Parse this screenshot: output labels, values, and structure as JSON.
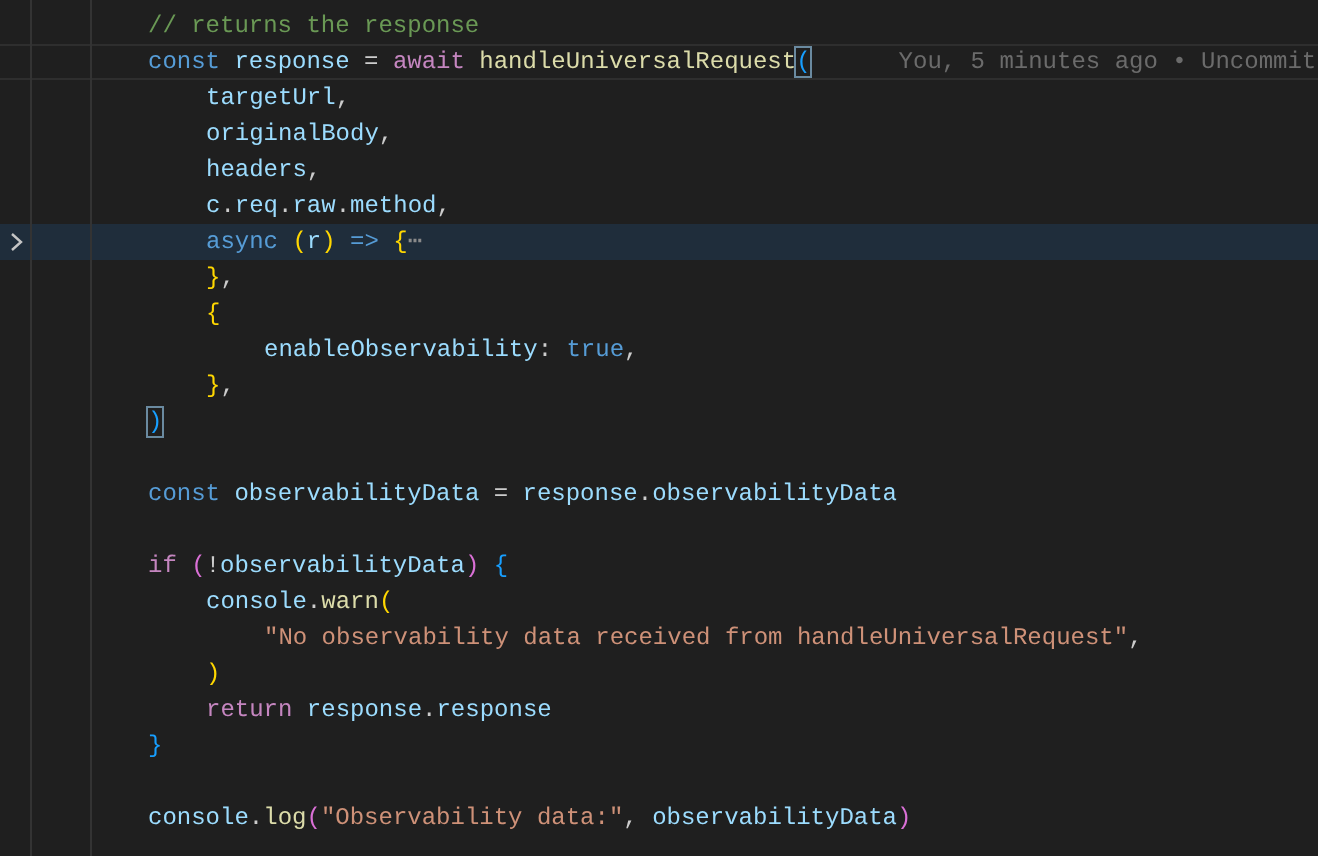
{
  "editor": {
    "lines": [
      {
        "kind": "code",
        "selected": false,
        "current": false,
        "folded": false,
        "tokens": [
          {
            "kind": "comment",
            "text": "// returns the response"
          }
        ]
      },
      {
        "kind": "code",
        "selected": false,
        "current": true,
        "folded": false,
        "tokens": [
          {
            "kind": "keyword",
            "text": "const "
          },
          {
            "kind": "var",
            "text": "response"
          },
          {
            "kind": "plain",
            "text": " = "
          },
          {
            "kind": "control",
            "text": "await "
          },
          {
            "kind": "func",
            "text": "handleUniversalRequest"
          },
          {
            "kind": "match",
            "text": "("
          }
        ],
        "blame": "You, 5 minutes ago • Uncommit",
        "children": [
          {
            "kind": "code",
            "selected": false,
            "current": false,
            "folded": false,
            "tokens": [
              {
                "kind": "var",
                "text": "targetUrl"
              },
              {
                "kind": "plain",
                "text": ","
              }
            ]
          },
          {
            "kind": "code",
            "selected": false,
            "current": false,
            "folded": false,
            "tokens": [
              {
                "kind": "var",
                "text": "originalBody"
              },
              {
                "kind": "plain",
                "text": ","
              }
            ]
          },
          {
            "kind": "code",
            "selected": false,
            "current": false,
            "folded": false,
            "tokens": [
              {
                "kind": "var",
                "text": "headers"
              },
              {
                "kind": "plain",
                "text": ","
              }
            ]
          },
          {
            "kind": "code",
            "selected": false,
            "current": false,
            "folded": false,
            "tokens": [
              {
                "kind": "var",
                "text": "c"
              },
              {
                "kind": "plain",
                "text": "."
              },
              {
                "kind": "var",
                "text": "req"
              },
              {
                "kind": "plain",
                "text": "."
              },
              {
                "kind": "var",
                "text": "raw"
              },
              {
                "kind": "plain",
                "text": "."
              },
              {
                "kind": "var",
                "text": "method"
              },
              {
                "kind": "plain",
                "text": ","
              }
            ]
          },
          {
            "kind": "code",
            "selected": true,
            "current": false,
            "folded": true,
            "tokens": [
              {
                "kind": "keyword",
                "text": "async "
              },
              {
                "kind": "paren1",
                "text": "("
              },
              {
                "kind": "var",
                "text": "r"
              },
              {
                "kind": "paren1",
                "text": ")"
              },
              {
                "kind": "keyword",
                "text": " => "
              },
              {
                "kind": "paren1",
                "text": "{"
              },
              {
                "kind": "fold",
                "text": "⋯"
              }
            ]
          },
          {
            "kind": "code",
            "selected": false,
            "current": false,
            "folded": false,
            "tokens": [
              {
                "kind": "paren1",
                "text": "}"
              },
              {
                "kind": "plain",
                "text": ","
              }
            ]
          },
          {
            "kind": "code",
            "selected": false,
            "current": false,
            "folded": false,
            "tokens": [
              {
                "kind": "paren1",
                "text": "{"
              }
            ],
            "children": [
              {
                "kind": "code",
                "selected": false,
                "current": false,
                "folded": false,
                "tokens": [
                  {
                    "kind": "var",
                    "text": "enableObservability"
                  },
                  {
                    "kind": "plain",
                    "text": ": "
                  },
                  {
                    "kind": "keyword",
                    "text": "true"
                  },
                  {
                    "kind": "plain",
                    "text": ","
                  }
                ]
              }
            ]
          },
          {
            "kind": "code",
            "selected": false,
            "current": false,
            "folded": false,
            "tokens": [
              {
                "kind": "paren1",
                "text": "}"
              },
              {
                "kind": "plain",
                "text": ","
              }
            ]
          }
        ]
      },
      {
        "kind": "code",
        "selected": false,
        "current": false,
        "folded": false,
        "tokens": [
          {
            "kind": "match",
            "text": ")"
          }
        ]
      },
      {
        "kind": "blank",
        "selected": false,
        "current": false,
        "folded": false
      },
      {
        "kind": "code",
        "selected": false,
        "current": false,
        "folded": false,
        "tokens": [
          {
            "kind": "keyword",
            "text": "const "
          },
          {
            "kind": "var",
            "text": "observabilityData"
          },
          {
            "kind": "plain",
            "text": " = "
          },
          {
            "kind": "var",
            "text": "response"
          },
          {
            "kind": "plain",
            "text": "."
          },
          {
            "kind": "var",
            "text": "observabilityData"
          }
        ]
      },
      {
        "kind": "blank",
        "selected": false,
        "current": false,
        "folded": false
      },
      {
        "kind": "code",
        "selected": false,
        "current": false,
        "folded": false,
        "tokens": [
          {
            "kind": "control",
            "text": "if "
          },
          {
            "kind": "paren2",
            "text": "("
          },
          {
            "kind": "plain",
            "text": "!"
          },
          {
            "kind": "var",
            "text": "observabilityData"
          },
          {
            "kind": "paren2",
            "text": ")"
          },
          {
            "kind": "paren3",
            "text": " {"
          }
        ],
        "children": [
          {
            "kind": "code",
            "selected": false,
            "current": false,
            "folded": false,
            "tokens": [
              {
                "kind": "var",
                "text": "console"
              },
              {
                "kind": "plain",
                "text": "."
              },
              {
                "kind": "func",
                "text": "warn"
              },
              {
                "kind": "paren1",
                "text": "("
              }
            ],
            "children": [
              {
                "kind": "code",
                "selected": false,
                "current": false,
                "folded": false,
                "tokens": [
                  {
                    "kind": "string",
                    "text": "\"No observability data received from handleUniversalRequest\""
                  },
                  {
                    "kind": "plain",
                    "text": ","
                  }
                ]
              }
            ]
          },
          {
            "kind": "code",
            "selected": false,
            "current": false,
            "folded": false,
            "tokens": [
              {
                "kind": "paren1",
                "text": ")"
              }
            ]
          },
          {
            "kind": "code",
            "selected": false,
            "current": false,
            "folded": false,
            "tokens": [
              {
                "kind": "control",
                "text": "return "
              },
              {
                "kind": "var",
                "text": "response"
              },
              {
                "kind": "plain",
                "text": "."
              },
              {
                "kind": "var",
                "text": "response"
              }
            ]
          }
        ]
      },
      {
        "kind": "code",
        "selected": false,
        "current": false,
        "folded": false,
        "tokens": [
          {
            "kind": "paren3",
            "text": "}"
          }
        ]
      },
      {
        "kind": "blank",
        "selected": false,
        "current": false,
        "folded": false
      },
      {
        "kind": "code",
        "selected": false,
        "current": false,
        "folded": false,
        "tokens": [
          {
            "kind": "var",
            "text": "console"
          },
          {
            "kind": "plain",
            "text": "."
          },
          {
            "kind": "func",
            "text": "log"
          },
          {
            "kind": "paren2",
            "text": "("
          },
          {
            "kind": "string",
            "text": "\"Observability data:\""
          },
          {
            "kind": "plain",
            "text": ", "
          },
          {
            "kind": "var",
            "text": "observabilityData"
          },
          {
            "kind": "paren2",
            "text": ")"
          }
        ]
      }
    ]
  }
}
